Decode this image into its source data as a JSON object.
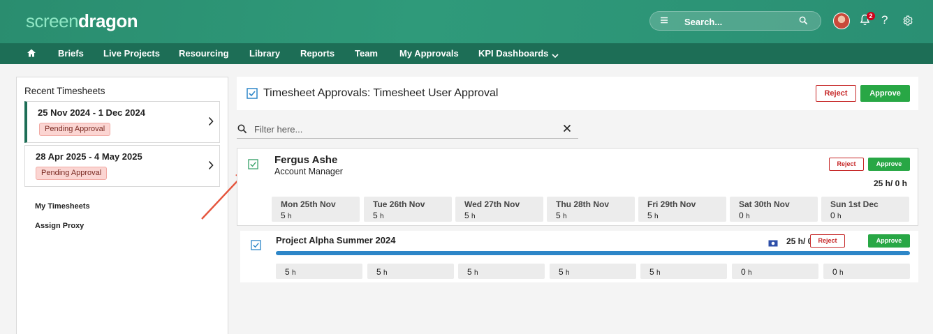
{
  "brand": {
    "part1": "screen",
    "part2": "dragon"
  },
  "header": {
    "search_placeholder": "Search...",
    "notification_count": "2",
    "help_label": "?"
  },
  "nav": {
    "items": [
      "Briefs",
      "Live Projects",
      "Resourcing",
      "Library",
      "Reports",
      "Team",
      "My Approvals",
      "KPI Dashboards"
    ]
  },
  "left_panel": {
    "title": "Recent Timesheets",
    "timesheets": [
      {
        "range": "25 Nov 2024 - 1 Dec 2024",
        "status": "Pending Approval"
      },
      {
        "range": "28 Apr 2025 - 4 May 2025",
        "status": "Pending Approval"
      }
    ],
    "links": [
      "My Timesheets",
      "Assign Proxy"
    ]
  },
  "main": {
    "title": "Timesheet Approvals: Timesheet User Approval",
    "reject_label": "Reject",
    "approve_label": "Approve",
    "filter_placeholder": "Filter here..."
  },
  "person": {
    "name": "Fergus Ashe",
    "role": "Account Manager",
    "total": "25 h/ 0 h",
    "reject_label": "Reject",
    "approve_label": "Approve",
    "days": [
      {
        "label": "Mon 25th Nov",
        "hours": "5",
        "unit": "h"
      },
      {
        "label": "Tue 26th Nov",
        "hours": "5",
        "unit": "h"
      },
      {
        "label": "Wed 27th Nov",
        "hours": "5",
        "unit": "h"
      },
      {
        "label": "Thu 28th Nov",
        "hours": "5",
        "unit": "h"
      },
      {
        "label": "Fri 29th Nov",
        "hours": "5",
        "unit": "h"
      },
      {
        "label": "Sat 30th Nov",
        "hours": "0",
        "unit": "h"
      },
      {
        "label": "Sun 1st Dec",
        "hours": "0",
        "unit": "h"
      }
    ]
  },
  "project": {
    "name": "Project Alpha Summer 2024",
    "total": "25 h/ 0 h",
    "reject_label": "Reject",
    "approve_label": "Approve",
    "progress": 1.0,
    "days": [
      {
        "hours": "5",
        "unit": "h"
      },
      {
        "hours": "5",
        "unit": "h"
      },
      {
        "hours": "5",
        "unit": "h"
      },
      {
        "hours": "5",
        "unit": "h"
      },
      {
        "hours": "5",
        "unit": "h"
      },
      {
        "hours": "0",
        "unit": "h"
      },
      {
        "hours": "0",
        "unit": "h"
      }
    ]
  },
  "colors": {
    "header_green": "#2f9a7a",
    "nav_green": "#1d6e56",
    "approve_green": "#28a745",
    "reject_red": "#c62828",
    "progress_blue": "#2d86c8",
    "annotation_arrow": "#e5553d"
  },
  "icons": [
    "home-icon",
    "menu-icon",
    "search-icon",
    "bell-icon",
    "help-icon",
    "gear-icon",
    "chevron-right-icon",
    "chevron-down-icon",
    "checkbox-icon",
    "close-icon",
    "money-icon"
  ]
}
